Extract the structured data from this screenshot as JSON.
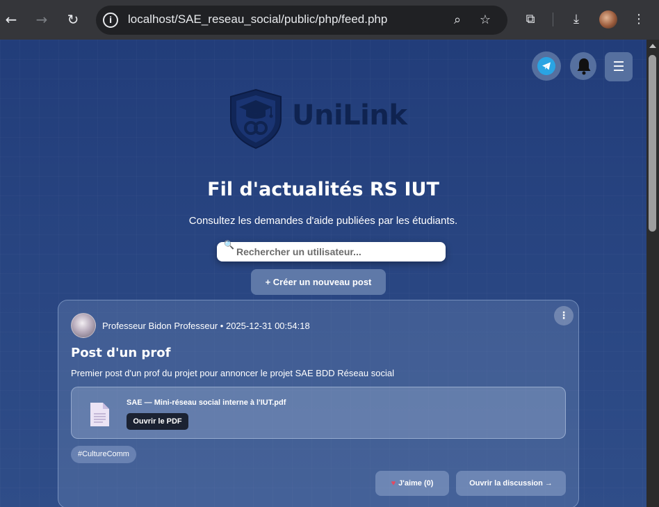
{
  "browser": {
    "url": "localhost/SAE_reseau_social/public/php/feed.php",
    "back_icon": "←",
    "forward_icon": "→",
    "reload_icon": "↻",
    "info_icon": "i",
    "zoom_icon": "⌕",
    "star_icon": "☆",
    "extensions_icon": "⧉",
    "download_icon": "⤓",
    "more_icon": "⋮"
  },
  "header": {
    "menu_icon": "☰"
  },
  "brand": {
    "name": "UniLink"
  },
  "page": {
    "title": "Fil d'actualités RS IUT",
    "subtitle": "Consultez les demandes d'aide publiées par les étudiants."
  },
  "search": {
    "icon": "🔍",
    "placeholder": "Rechercher un utilisateur...",
    "value": ""
  },
  "actions": {
    "create_post_label": "+ Créer un nouveau post"
  },
  "post": {
    "meta": "Professeur Bidon Professeur • 2025-12-31 00:54:18",
    "more_icon": "⋮",
    "title": "Post d'un prof",
    "body": "Premier post d'un prof du projet pour annoncer le projet SAE BDD Réseau social",
    "attachment": {
      "filename": "SAE — Mini-réseau social interne à l'IUT.pdf",
      "open_label": "Ouvrir le PDF"
    },
    "tag": "#CultureComm",
    "like_heart": "♥",
    "like_label": "J'aime (0)",
    "discussion_label": "Ouvrir la discussion →"
  },
  "colors": {
    "background": "#223d7a",
    "logo": "#0f2350",
    "telegram": "#2aa4e3",
    "heart": "#e5485f"
  }
}
